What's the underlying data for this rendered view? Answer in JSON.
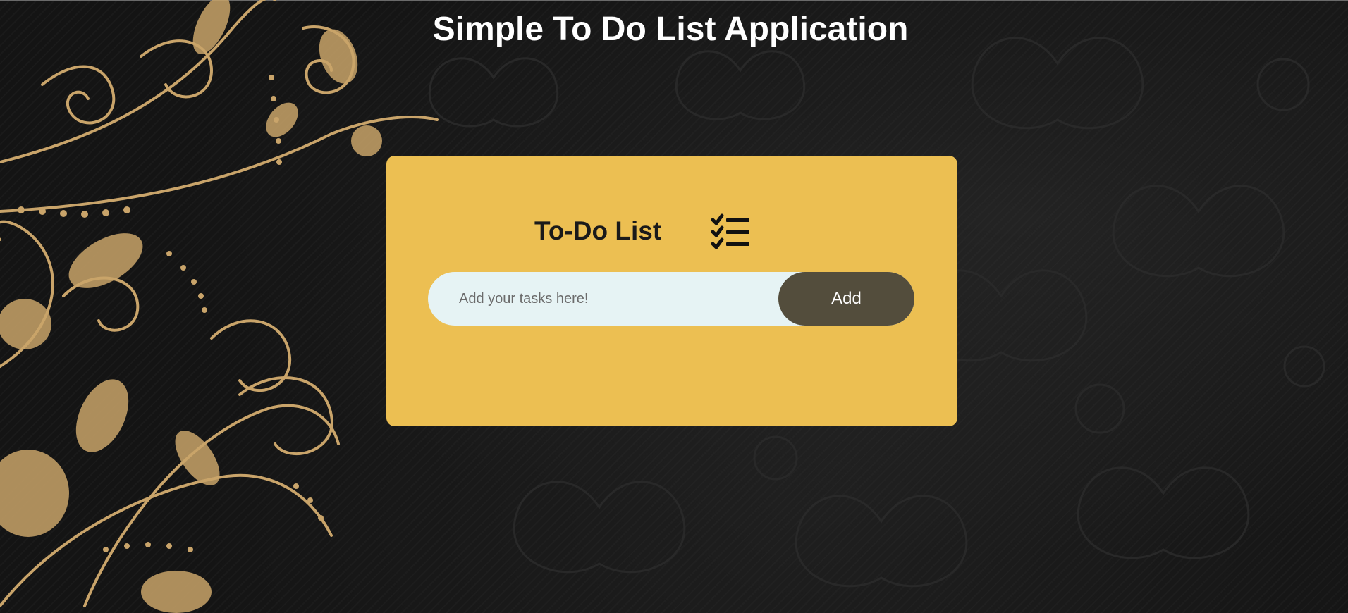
{
  "page": {
    "title": "Simple To Do List Application"
  },
  "todo": {
    "heading": "To-Do List",
    "icon": "checklist-icon",
    "input_placeholder": "Add your tasks here!",
    "input_value": "",
    "add_label": "Add"
  },
  "colors": {
    "background": "#141414",
    "card": "#ecbf52",
    "input_bg": "#e6f3f4",
    "button": "#534d3c",
    "floral_gold": "#c9a46a"
  }
}
